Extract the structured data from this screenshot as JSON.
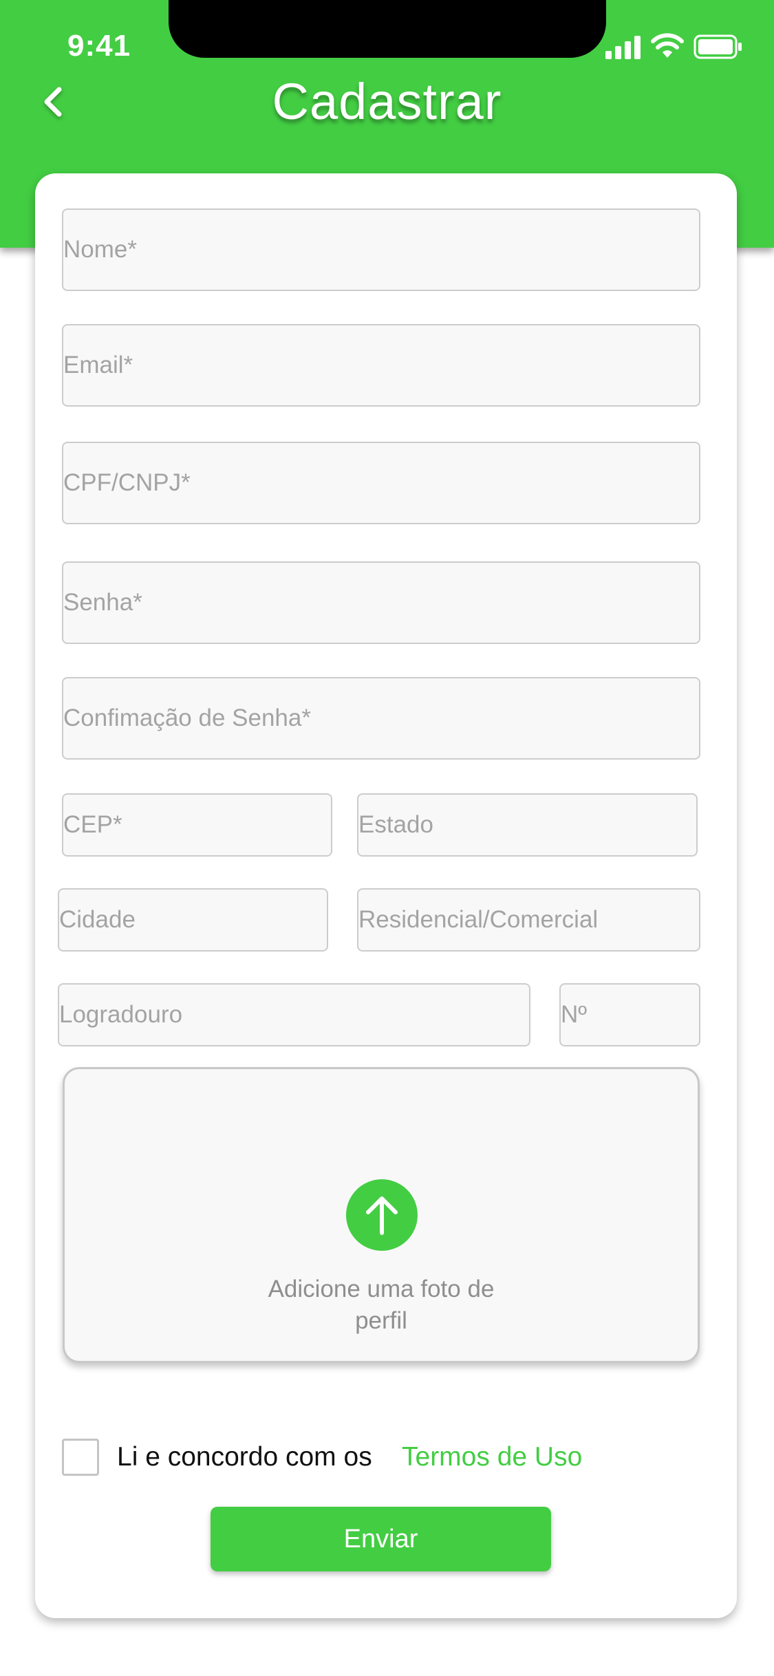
{
  "status_bar": {
    "time": "9:41",
    "icons": [
      "signal-icon",
      "wifi-icon",
      "battery-icon"
    ]
  },
  "header": {
    "title": "Cadastrar",
    "back_icon": "chevron-left-icon"
  },
  "form": {
    "name_placeholder": "Nome*",
    "email_placeholder": "Email*",
    "document_placeholder": "CPF/CNPJ*",
    "password_placeholder": "Senha*",
    "password_confirm_placeholder": "Confimação de Senha*",
    "cep_placeholder": "CEP*",
    "state_placeholder": "Estado",
    "city_placeholder": "Cidade",
    "address_type_placeholder": "Residencial/Comercial",
    "street_placeholder": "Logradouro",
    "number_placeholder": "Nº"
  },
  "upload": {
    "label": "Adicione uma foto de perfil",
    "icon": "arrow-up-icon"
  },
  "terms": {
    "text": "Li e concordo com os",
    "link": "Termos de Uso"
  },
  "submit_label": "Enviar",
  "colors": {
    "brand_green": "#43cd43",
    "field_background": "#f8f8f8",
    "field_border": "#cccccc",
    "placeholder": "#a3a3a3"
  }
}
